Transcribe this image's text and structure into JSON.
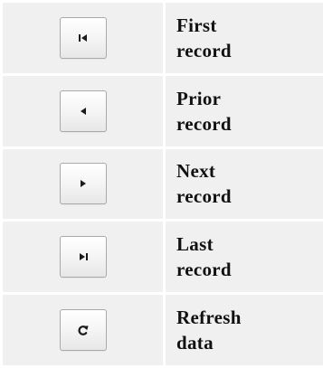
{
  "rows": [
    {
      "icon": "first-record-icon",
      "label_line1": "First",
      "label_line2": "record"
    },
    {
      "icon": "prior-record-icon",
      "label_line1": "Prior",
      "label_line2": "record"
    },
    {
      "icon": "next-record-icon",
      "label_line1": "Next",
      "label_line2": "record"
    },
    {
      "icon": "last-record-icon",
      "label_line1": "Last",
      "label_line2": "record"
    },
    {
      "icon": "refresh-icon",
      "label_line1": "Refresh",
      "label_line2": "data"
    }
  ],
  "colors": {
    "cell_background": "#f0f0f0",
    "icon": "#1a1a1a",
    "label_text": "#111111"
  }
}
